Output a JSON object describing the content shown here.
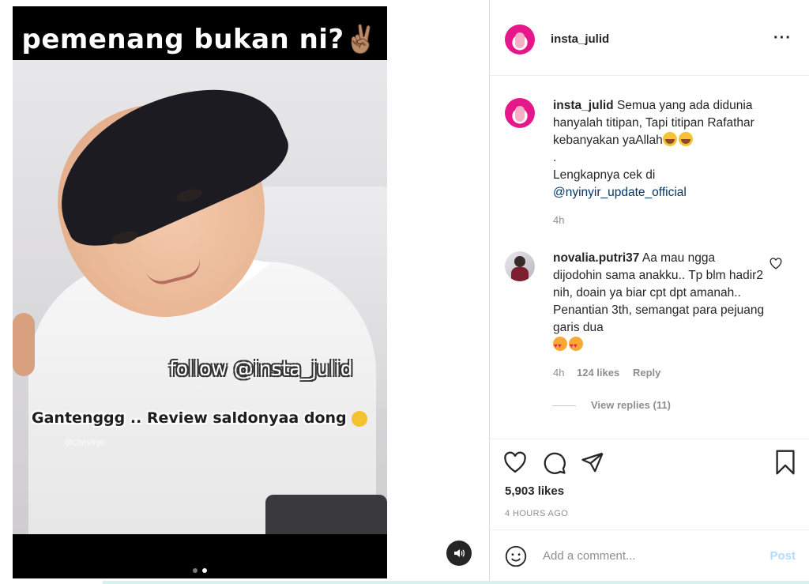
{
  "media": {
    "video_title": "pemenang bukan ni?✌🏽",
    "overlay_follow": "follow @insta_julid",
    "overlay_review": "Gantenggg .. Review saldonyaa dong",
    "watermark": "@CheVirgo",
    "carousel": {
      "count": 2,
      "active_index": 1
    },
    "sound_icon": "speaker-icon"
  },
  "header": {
    "username": "insta_julid",
    "more_icon": "more-horizontal-icon"
  },
  "caption": {
    "username": "insta_julid",
    "text_1": "Semua yang ada didunia hanyalah titipan, Tapi titipan Rafathar kebanyakan yaAllah",
    "dot": ".",
    "text_2": "Lengkapnya cek di",
    "mention": "@nyinyir_update_official",
    "time": "4h"
  },
  "comment": {
    "username": "novalia.putri37",
    "text": "Aa mau ngga dijodohin sama anakku.. Tp blm hadir2 nih, doain ya biar cpt dpt amanah.. Penantian 3th, semangat para pejuang garis dua",
    "time": "4h",
    "likes": "124 likes",
    "reply": "Reply",
    "view_replies": "View replies (11)"
  },
  "actions": {
    "likes": "5,903 likes",
    "timestamp": "4 HOURS AGO",
    "icons": [
      "heart-icon",
      "comment-icon",
      "share-icon",
      "bookmark-icon"
    ]
  },
  "comment_box": {
    "placeholder": "Add a comment...",
    "post_label": "Post",
    "emoji_icon": "emoji-icon"
  },
  "colors": {
    "brand_pink": "#e6178a",
    "link": "#00376b",
    "post_disabled": "#b3dbff",
    "muted": "#8e8e8e"
  }
}
